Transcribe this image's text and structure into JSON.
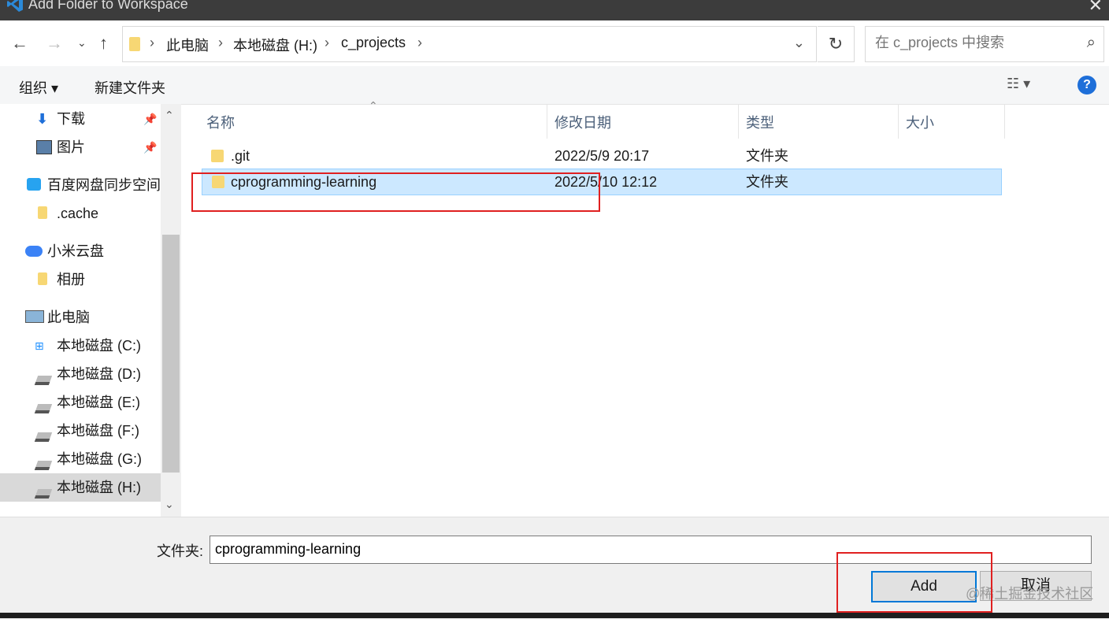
{
  "window": {
    "title": "Add Folder to Workspace"
  },
  "nav": {
    "breadcrumb": [
      "此电脑",
      "本地磁盘 (H:)",
      "c_projects"
    ],
    "search_placeholder": "在 c_projects 中搜索"
  },
  "toolbar": {
    "organize": "组织 ▾",
    "new_folder": "新建文件夹"
  },
  "sidebar": {
    "items": [
      {
        "label": "下载",
        "icon": "download-icon",
        "pinned": true
      },
      {
        "label": "图片",
        "icon": "pictures-icon",
        "pinned": true
      },
      {
        "label": "百度网盘同步空间",
        "icon": "baidu-netdisk-icon"
      },
      {
        "label": ".cache",
        "icon": "folder-icon"
      },
      {
        "label": "小米云盘",
        "icon": "cloud-icon"
      },
      {
        "label": "相册",
        "icon": "folder-icon"
      },
      {
        "label": "此电脑",
        "icon": "computer-icon"
      },
      {
        "label": "本地磁盘 (C:)",
        "icon": "windows-drive-icon"
      },
      {
        "label": "本地磁盘 (D:)",
        "icon": "drive-icon"
      },
      {
        "label": "本地磁盘 (E:)",
        "icon": "drive-icon"
      },
      {
        "label": "本地磁盘 (F:)",
        "icon": "drive-icon"
      },
      {
        "label": "本地磁盘 (G:)",
        "icon": "drive-icon"
      },
      {
        "label": "本地磁盘 (H:)",
        "icon": "drive-icon",
        "selected": true
      }
    ]
  },
  "list": {
    "columns": [
      "名称",
      "修改日期",
      "类型",
      "大小"
    ],
    "rows": [
      {
        "name": ".git",
        "date": "2022/5/9 20:17",
        "type": "文件夹",
        "size": ""
      },
      {
        "name": "cprogramming-learning",
        "date": "2022/5/10 12:12",
        "type": "文件夹",
        "size": "",
        "selected": true
      }
    ]
  },
  "footer": {
    "folder_label": "文件夹:",
    "folder_value": "cprogramming-learning",
    "add_label": "Add",
    "cancel_label": "取消",
    "watermark": "@稀土掘金技术社区"
  },
  "colors": {
    "accent": "#0078d7",
    "selection": "#cce8ff",
    "highlight_box": "#e02020"
  }
}
